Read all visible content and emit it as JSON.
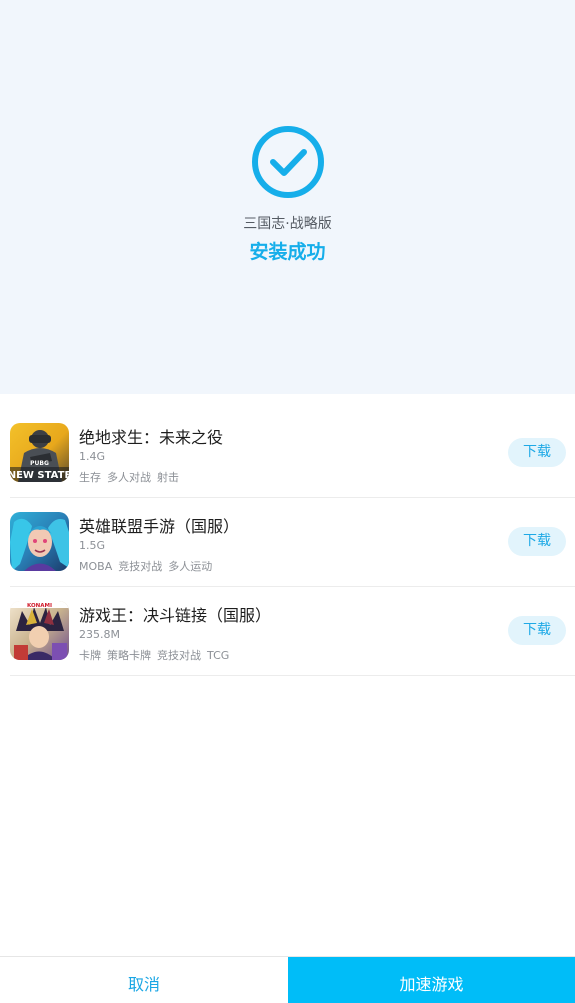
{
  "hero": {
    "app_name": "三国志·战略版",
    "status": "安装成功"
  },
  "games": [
    {
      "title": "绝地求生：未来之役",
      "size": "1.4G",
      "tags": [
        "生存",
        "多人对战",
        "射击"
      ],
      "button": "下载",
      "icon": "pubg-new-state-icon",
      "icon_text": [
        "PUBG",
        "NEW STATE"
      ]
    },
    {
      "title": "英雄联盟手游（国服）",
      "size": "1.5G",
      "tags": [
        "MOBA",
        "竞技对战",
        "多人运动"
      ],
      "button": "下载",
      "icon": "league-of-legends-icon"
    },
    {
      "title": "游戏王：决斗链接（国服）",
      "size": "235.8M",
      "tags": [
        "卡牌",
        "策略卡牌",
        "竞技对战",
        "TCG"
      ],
      "button": "下载",
      "icon": "yugioh-duel-links-icon",
      "icon_text": [
        "KONAMI"
      ]
    }
  ],
  "footer": {
    "cancel": "取消",
    "accelerate": "加速游戏"
  },
  "colors": {
    "accent": "#16aeea",
    "primary_button": "#00bdf8",
    "hero_background": "#f1f6fc"
  }
}
